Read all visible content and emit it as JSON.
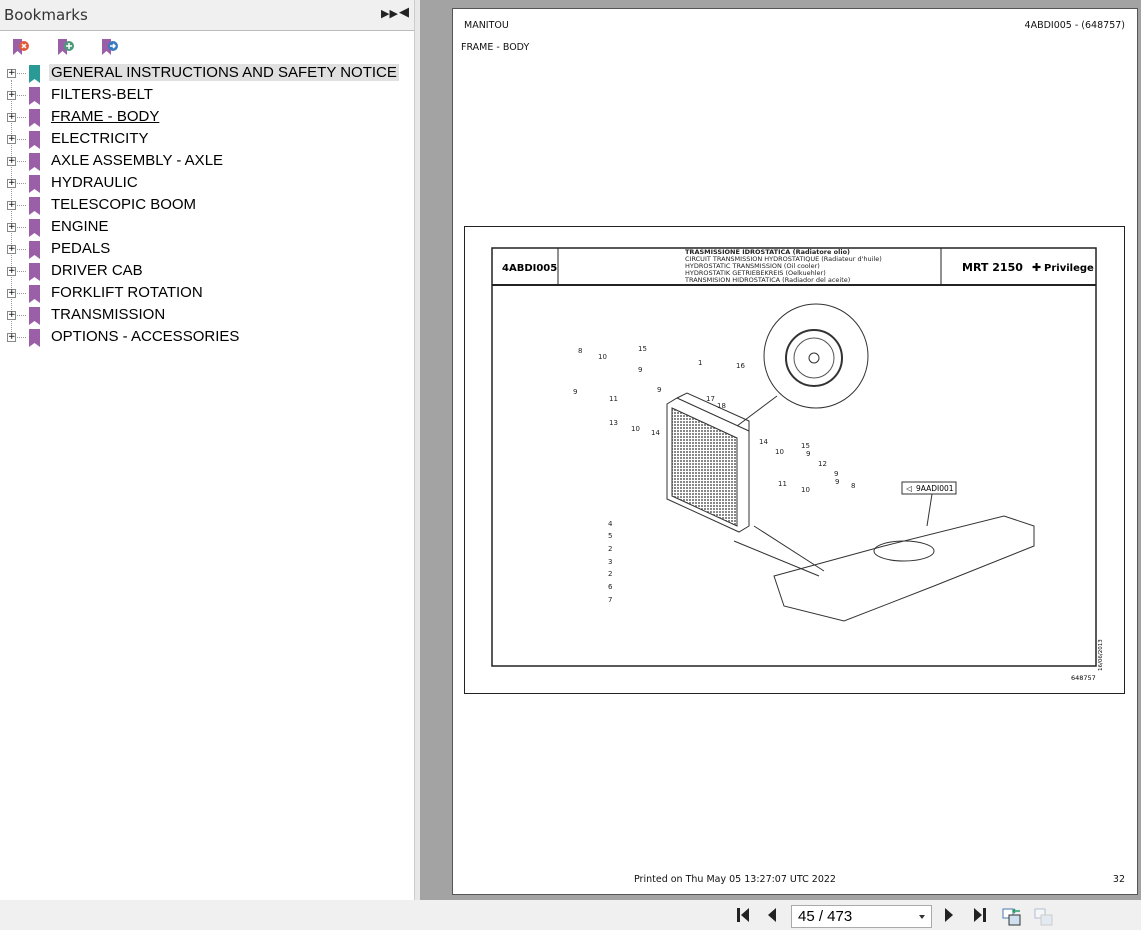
{
  "sidebar": {
    "title": "Bookmarks",
    "tools": [
      "delete-bookmark",
      "add-bookmark",
      "go-to-bookmark"
    ],
    "items": [
      {
        "label": "GENERAL INSTRUCTIONS AND SAFETY NOTICE"
      },
      {
        "label": "FILTERS-BELT"
      },
      {
        "label": "FRAME - BODY"
      },
      {
        "label": "ELECTRICITY"
      },
      {
        "label": "AXLE ASSEMBLY - AXLE"
      },
      {
        "label": "HYDRAULIC"
      },
      {
        "label": "TELESCOPIC BOOM"
      },
      {
        "label": "ENGINE"
      },
      {
        "label": "PEDALS"
      },
      {
        "label": "DRIVER CAB"
      },
      {
        "label": "FORKLIFT ROTATION"
      },
      {
        "label": "TRANSMISSION"
      },
      {
        "label": "OPTIONS - ACCESSORIES"
      }
    ]
  },
  "colors": {
    "bookmark": "#9b5fa8",
    "bookmark_selected": "#2a9a96"
  },
  "page": {
    "brand": "MANITOU",
    "ref": "4ABDI005 - (648757)",
    "section": "FRAME - BODY",
    "drawing": {
      "code": "4ABDI005",
      "titles": [
        "TRASMISSIONE IDROSTATICA (Radiatore olio)",
        "CIRCUIT TRANSMISSION HYDROSTATIQUE (Radiateur d'huile)",
        "HYDROSTATIC TRANSMISSION (Oil cooler)",
        "HYDROSTATIK GETRIEBEKREIS (Oelkuehler)",
        "TRANSMISION HIDROSTATICA (Radiador del aceite)"
      ],
      "model": "MRT 2150",
      "model_suffix": "Privilege",
      "ref_box": "9AADI001",
      "number": "648757",
      "side_code": "16/06/2013",
      "callouts": [
        "8",
        "10",
        "15",
        "9",
        "9",
        "11",
        "13",
        "10",
        "9",
        "14",
        "1",
        "16",
        "17",
        "18",
        "14",
        "10",
        "15",
        "9",
        "12",
        "9",
        "11",
        "10",
        "9",
        "8",
        "4",
        "5",
        "2",
        "3",
        "2",
        "6",
        "7"
      ]
    },
    "footer": {
      "printed": "Printed on  Thu May 05 13:27:07 UTC 2022",
      "page_number": "32"
    }
  },
  "nav": {
    "page_value": "45 / 473"
  }
}
